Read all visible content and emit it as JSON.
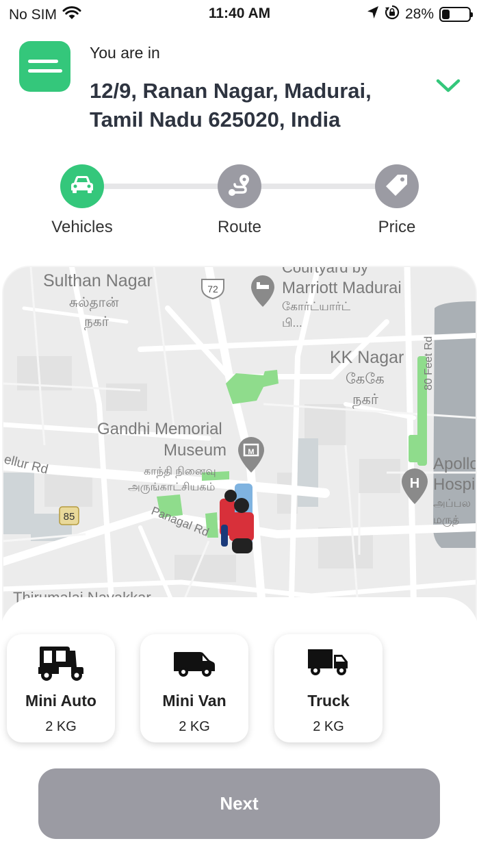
{
  "status_bar": {
    "carrier": "No SIM",
    "time": "11:40 AM",
    "battery": "28%",
    "battery_level": 0.28,
    "icons": [
      "wifi-icon",
      "location-arrow-icon",
      "orientation-lock-icon",
      "battery-icon"
    ]
  },
  "header": {
    "menu_icon": "menu-icon",
    "you_are_in": "You are in",
    "address": "12/9, Ranan Nagar, Madurai, Tamil Nadu 625020, India",
    "dropdown_icon": "chevron-down-icon"
  },
  "steps": [
    {
      "label": "Vehicles",
      "icon": "car-icon",
      "active": true
    },
    {
      "label": "Route",
      "icon": "route-icon",
      "active": false
    },
    {
      "label": "Price",
      "icon": "price-tag-icon",
      "active": false
    }
  ],
  "map": {
    "labels": {
      "sulthan_nagar": "Sulthan Nagar",
      "sulthan_nagar_ta1": "சுல்தான்",
      "sulthan_nagar_ta2": "நகர்",
      "route_72": "72",
      "courtyard_1": "Courtyard by",
      "courtyard_2": "Marriott Madurai",
      "courtyard_ta1": "கோர்ட்யார்ட்",
      "courtyard_ta2": "பி...",
      "kk_nagar": "KK Nagar",
      "kk_nagar_ta1": "கேகே",
      "kk_nagar_ta2": "நகர்",
      "feet_rd": "80 Feet Rd",
      "gandhi_1": "Gandhi Memorial",
      "gandhi_2": "Museum",
      "gandhi_ta1": "காந்தி நினைவு",
      "gandhi_ta2": "அருங்காட்சியகம்",
      "apollo_1": "Apollo",
      "apollo_2": "Hospi",
      "apollo_ta1": "அப்பல",
      "apollo_ta2": "மருத்",
      "ellur_rd": "ellur Rd",
      "route_85": "85",
      "panagal_rd": "Panagal Rd",
      "thirumalai": "Thirumalai Nayakkar"
    },
    "colors": {
      "background": "#ececec",
      "road": "#ffffff",
      "park": "#8fdc8c",
      "water": "#aab0b5",
      "poi": "#8a8a8a"
    }
  },
  "vehicles": [
    {
      "name": "Mini Auto",
      "weight": "2 KG",
      "icon": "auto-rickshaw-icon"
    },
    {
      "name": "Mini Van",
      "weight": "2 KG",
      "icon": "van-icon"
    },
    {
      "name": "Truck",
      "weight": "2 KG",
      "icon": "truck-icon"
    }
  ],
  "next_button": "Next",
  "colors": {
    "accent": "#34c77b",
    "inactive": "#9b9ba3",
    "address_text": "#2e3440"
  }
}
